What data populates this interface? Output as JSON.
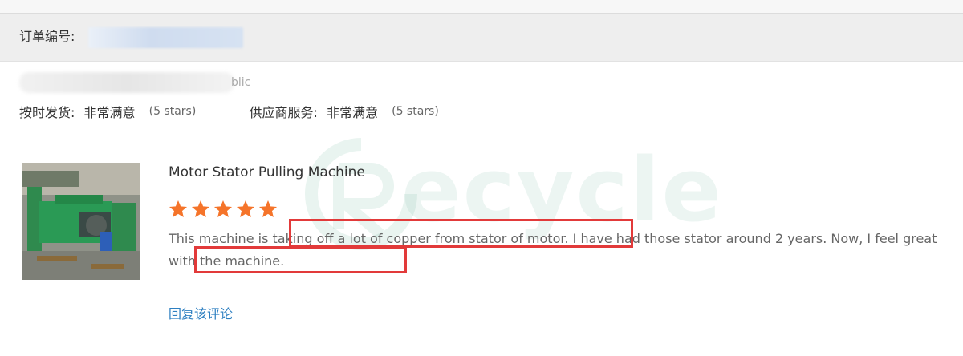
{
  "order": {
    "label": "订单编号:"
  },
  "buyer": {
    "name_suffix": "blic"
  },
  "ratings": {
    "delivery_label": "按时发货:",
    "delivery_value": "非常满意",
    "delivery_stars": "(5 stars)",
    "service_label": "供应商服务:",
    "service_value": "非常满意",
    "service_stars": "(5 stars)"
  },
  "watermark": {
    "text": "ecycle"
  },
  "review": {
    "product_title": "Motor Stator Pulling Machine",
    "star_rating": 5,
    "star_color": "#f5742a",
    "text": "This machine is taking off a lot of copper from stator of motor. I have had those stator around 2 years. Now, I feel great with the machine.",
    "reply_link": "回复该评论"
  },
  "colors": {
    "highlight": "#e23a3a",
    "link": "#2d7fc1"
  }
}
